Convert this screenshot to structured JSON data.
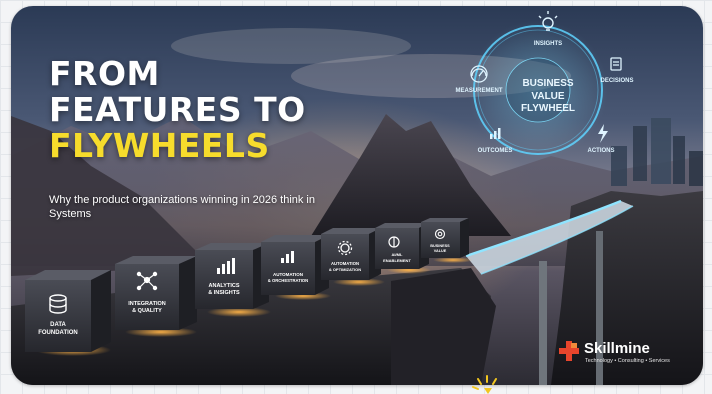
{
  "banner": {
    "title_line1": "FROM",
    "title_line2": "FEATURES TO",
    "title_line3": "FLYWHEELS",
    "subtitle": "Why the product organizations  winning in 2026 think in Systems"
  },
  "steps": [
    {
      "label_1": "DATA",
      "label_2": "FOUNDATION",
      "icon": "database-icon"
    },
    {
      "label_1": "INTEGRATION",
      "label_2": "& QUALITY",
      "icon": "network-icon"
    },
    {
      "label_1": "ANALYTICS",
      "label_2": "& INSIGHTS",
      "icon": "bar-chart-icon"
    },
    {
      "label_1": "AUTOMATION",
      "label_2": "& ORCHESTRATION",
      "icon": "bar-chart-icon"
    },
    {
      "label_1": "AUTOMATION",
      "label_2": "& OPTIMIZATION",
      "icon": "gear-icon"
    },
    {
      "label_1": "AI/ML",
      "label_2": "ENABLEMENT",
      "icon": "brain-icon"
    },
    {
      "label_1": "BUSINESS",
      "label_2": "VALUE",
      "icon": "target-icon"
    }
  ],
  "flywheel": {
    "center_line1": "BUSINESS",
    "center_line2": "VALUE",
    "center_line3": "FLYWHEEL",
    "nodes": [
      {
        "label": "INSIGHTS",
        "icon": "lightbulb-icon"
      },
      {
        "label": "DECISIONS",
        "icon": "clipboard-icon"
      },
      {
        "label": "ACTIONS",
        "icon": "lightning-icon"
      },
      {
        "label": "OUTCOMES",
        "icon": "bar-chart-icon"
      },
      {
        "label": "MEASUREMENT",
        "icon": "gauge-icon"
      }
    ],
    "glow_color": "#5fd3ff"
  },
  "logo": {
    "name": "Skillmine",
    "tagline": "Technology • Consulting • Services",
    "mark_color": "#e8452c"
  },
  "colors": {
    "title_white": "#ffffff",
    "title_yellow": "#f7dc2c"
  }
}
